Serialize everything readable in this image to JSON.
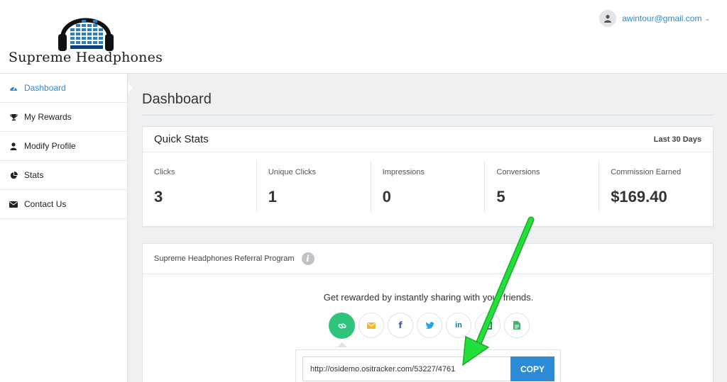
{
  "header": {
    "logo_text": "Supreme Headphones",
    "user_email": "awintour@gmail.com"
  },
  "sidebar": {
    "items": [
      {
        "label": "Dashboard",
        "icon": "dashboard-icon",
        "active": true
      },
      {
        "label": "My Rewards",
        "icon": "trophy-icon",
        "active": false
      },
      {
        "label": "Modify Profile",
        "icon": "user-icon",
        "active": false
      },
      {
        "label": "Stats",
        "icon": "pie-chart-icon",
        "active": false
      },
      {
        "label": "Contact Us",
        "icon": "envelope-icon",
        "active": false
      }
    ]
  },
  "main": {
    "page_title": "Dashboard",
    "quick_stats": {
      "title": "Quick Stats",
      "range": "Last 30 Days",
      "stats": [
        {
          "label": "Clicks",
          "value": "3"
        },
        {
          "label": "Unique Clicks",
          "value": "1"
        },
        {
          "label": "Impressions",
          "value": "0"
        },
        {
          "label": "Conversions",
          "value": "5"
        },
        {
          "label": "Commission Earned",
          "value": "$169.40"
        }
      ]
    },
    "referral": {
      "title": "Supreme Headphones Referral Program",
      "message": "Get rewarded by instantly sharing with your friends.",
      "share_buttons": [
        {
          "icon": "link-icon",
          "glyph": "⚭"
        },
        {
          "icon": "email-icon",
          "glyph": "✉"
        },
        {
          "icon": "facebook-icon",
          "glyph": "f"
        },
        {
          "icon": "twitter-icon",
          "glyph": "🐦"
        },
        {
          "icon": "linkedin-icon",
          "glyph": "in"
        },
        {
          "icon": "qr-icon",
          "glyph": "▦"
        },
        {
          "icon": "document-icon",
          "glyph": "▤"
        }
      ],
      "url": "http://osidemo.ositracker.com/53227/4761",
      "copy_label": "COPY"
    }
  },
  "colors": {
    "accent": "#2c8ad6",
    "share_active": "#2fc47c",
    "annotation_arrow": "#22e03a"
  }
}
